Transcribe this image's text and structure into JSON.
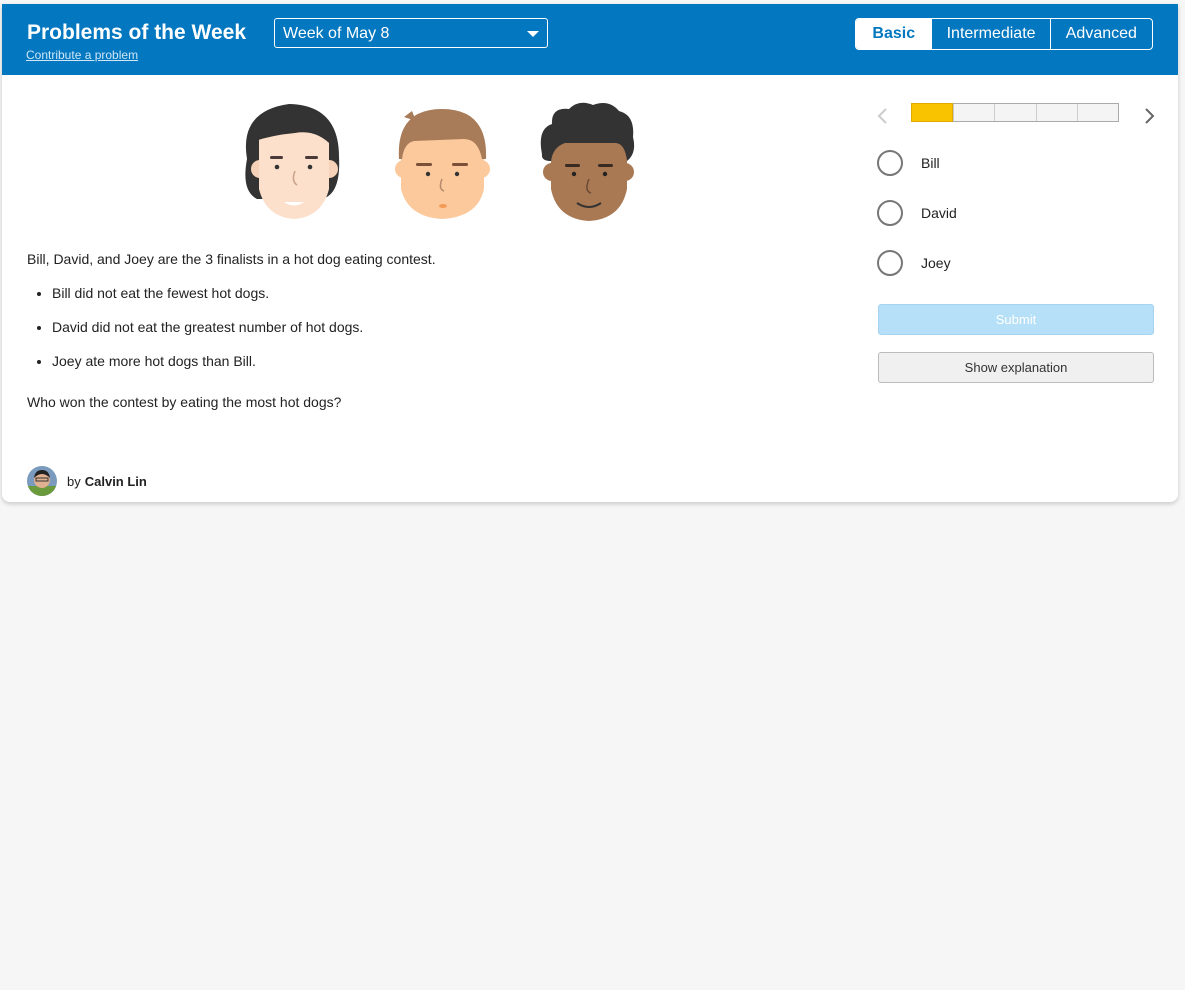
{
  "header": {
    "title": "Problems of the Week",
    "contribute_link": "Contribute a problem",
    "week_select": "Week of May 8",
    "levels": [
      "Basic",
      "Intermediate",
      "Advanced"
    ],
    "active_level": "Basic",
    "accent_color": "#0377bf"
  },
  "illustration": {
    "faces": [
      "bill-face-icon",
      "david-face-icon",
      "joey-face-icon"
    ]
  },
  "problem": {
    "intro": "Bill, David, and Joey are the 3 finalists in a hot dog eating contest.",
    "clues": [
      "Bill did not eat the fewest hot dogs.",
      "David did not eat the greatest number of hot dogs.",
      "Joey ate more hot dogs than Bill."
    ],
    "question": "Who won the contest by eating the most hot dogs?"
  },
  "author": {
    "prefix": "by",
    "name": "Calvin Lin"
  },
  "sidebar": {
    "progress": {
      "current": 1,
      "total": 5
    },
    "options": [
      "Bill",
      "David",
      "Joey"
    ],
    "submit_label": "Submit",
    "explanation_label": "Show explanation"
  }
}
